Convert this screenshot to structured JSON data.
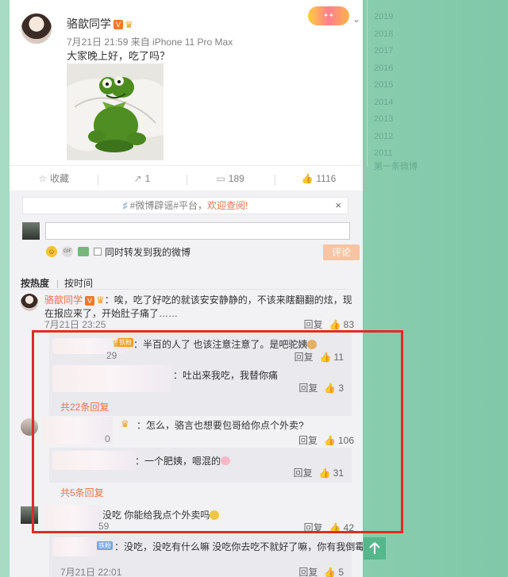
{
  "post": {
    "author": "骆歆同学",
    "vip_badge": "V",
    "meta": "7月21日 21:59 来自 iPhone 11 Pro Max",
    "text": "大家晚上好，吃了吗？"
  },
  "actions": {
    "favorite": "收藏",
    "repost": "1",
    "comments": "189",
    "likes": "1116"
  },
  "notice": {
    "prefix": "#微博辟谣#平台，",
    "highlight": "欢迎查阅!",
    "close": "×"
  },
  "composer": {
    "repost_checkbox": "同时转发到我的微博",
    "submit": "评论"
  },
  "sort": {
    "hot": "按热度",
    "time": "按时间"
  },
  "comments": [
    {
      "name": "骆歆同学",
      "text": "：唉，吃了好吃的就该安安静静的，不该来瞎翻翻的炫，现在报应来了，开始肚子痛了……",
      "time": "7月21日 23:25",
      "reply": "回复",
      "likes": "83"
    }
  ],
  "replies_1": [
    {
      "text": "：半百的人了 也该注意注意了。是吧驼姨",
      "time_fragment": "29",
      "reply": "回复",
      "likes": "11"
    },
    {
      "text": "：吐出来我吃，我替你痛",
      "reply": "回复",
      "likes": "3"
    }
  ],
  "more_replies_1": "共22条回复",
  "comment_2": {
    "text": "：怎么，骆言也想要包哥给你点个外卖?",
    "time_fragment": "0",
    "reply": "回复",
    "likes": "106"
  },
  "replies_2": [
    {
      "text": "：一个肥姨，嗯混的",
      "reply": "回复",
      "likes": "31"
    }
  ],
  "more_replies_2": "共5条回复",
  "comment_3": {
    "text": "没吃 你能给我点个外卖吗",
    "time_fragment": "59",
    "reply": "回复",
    "likes": "42"
  },
  "comment_4": {
    "badge": "铁粉",
    "text": "：没吃，没吃有什么嘛 没吃你去吃不就好了嘛，你有我倒霉",
    "time": "7月21日 22:01",
    "reply": "回复",
    "likes": "5"
  },
  "timeline": {
    "years": [
      "2019",
      "2018",
      "2017",
      "2016",
      "2015",
      "2014",
      "2013",
      "2012",
      "2011"
    ],
    "first_post": "第一条微博"
  },
  "colors": {
    "accent": "#eb7350",
    "highlight_box": "#e02c24",
    "page_background": "#8fcfb2"
  }
}
